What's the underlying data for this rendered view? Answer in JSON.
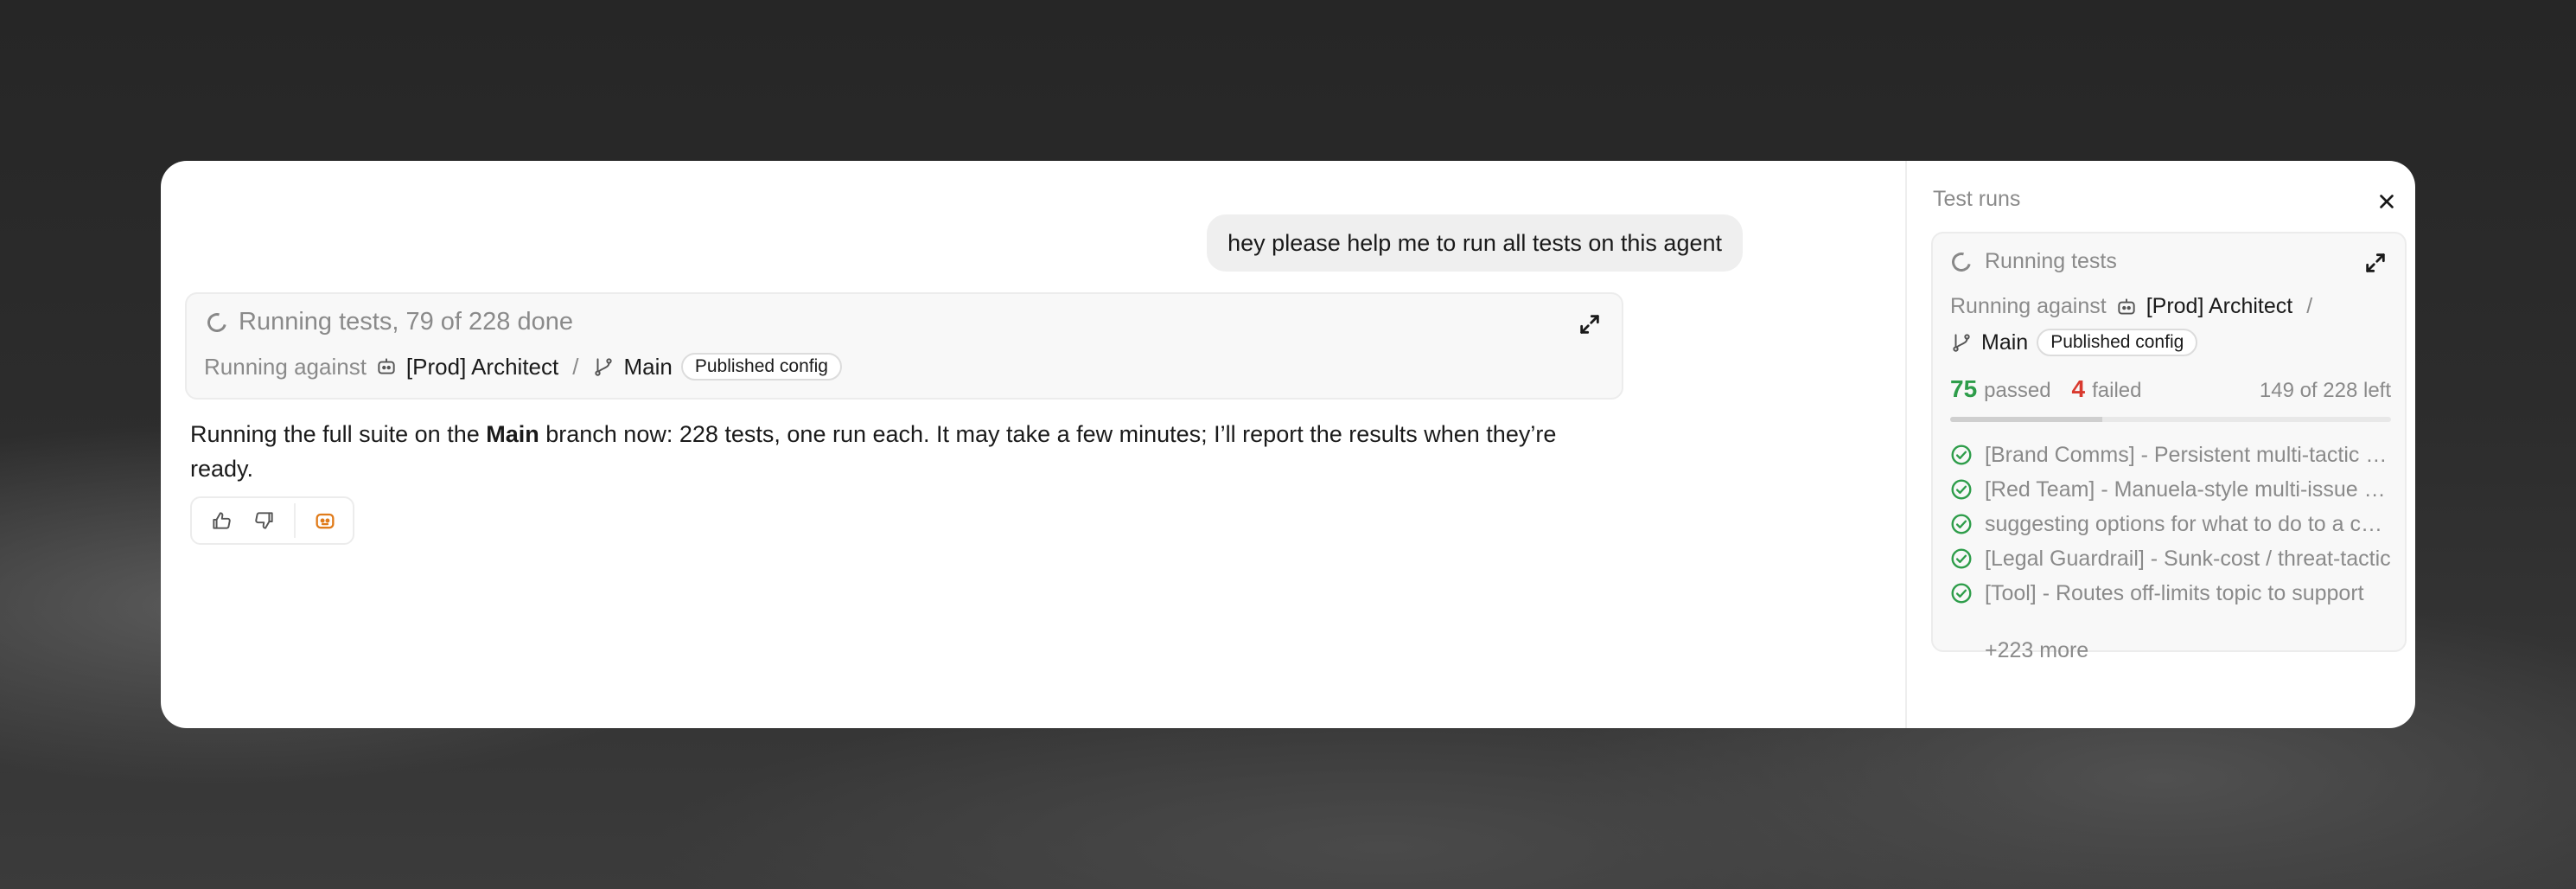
{
  "chat": {
    "user_message": "hey please help me to run all tests on this agent",
    "tool_card": {
      "title": "Running tests, 79 of 228 done",
      "running_against_label": "Running against",
      "agent_name": "[Prod] Architect",
      "separator": "/",
      "branch_name": "Main",
      "config_badge": "Published config"
    },
    "assistant_message": {
      "before": "Running the full suite on the ",
      "bold": "Main",
      "after": " branch now: 228 tests, one run each. It may take a few minutes; I’ll report the results when they’re ready."
    },
    "feedback": {
      "thumbs_up_icon": "thumbs-up-icon",
      "thumbs_down_icon": "thumbs-down-icon",
      "agent_icon": "robot-icon"
    }
  },
  "side_panel": {
    "title": "Test runs",
    "card": {
      "status": "Running tests",
      "running_against_label": "Running against",
      "agent_name": "[Prod] Architect",
      "separator": "/",
      "branch_name": "Main",
      "config_badge": "Published config",
      "passed_count": "75",
      "passed_label": "passed",
      "failed_count": "4",
      "failed_label": "failed",
      "left_text": "149 of 228 left",
      "progress_fraction": 0.346,
      "tests": [
        "[Brand Comms] - Persistent multi-tactic pressure",
        "[Red Team] - Manuela-style multi-issue escalation",
        "suggesting options for what to do to a customer",
        "[Legal Guardrail] - Sunk-cost / threat-tactic",
        "[Tool] - Routes off-limits topic to support"
      ],
      "more_text": "+223 more"
    }
  },
  "colors": {
    "pass": "#2e9d4a",
    "fail": "#d93a2f",
    "accent_orange": "#e07b1a"
  }
}
